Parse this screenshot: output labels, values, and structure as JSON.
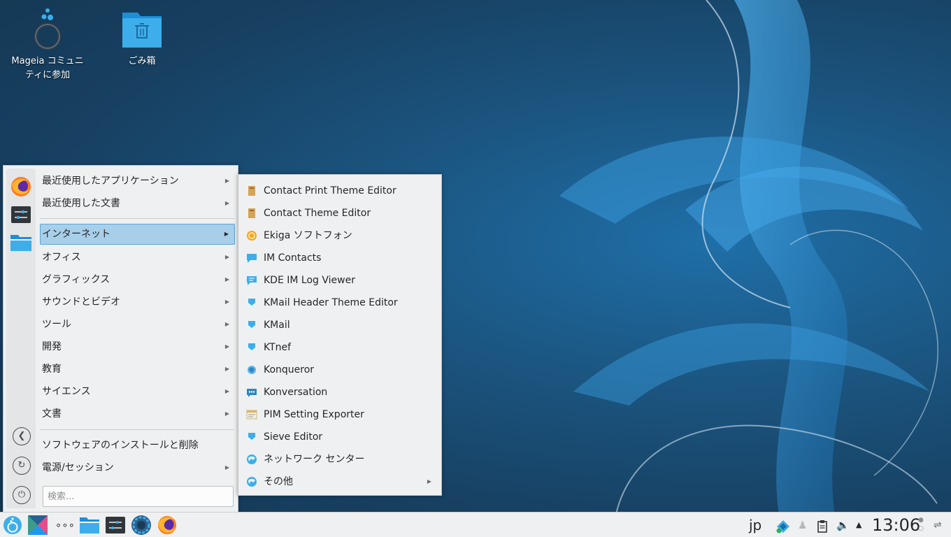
{
  "desktop": {
    "icons": [
      {
        "label": "Mageia コミュニ\nティに参加",
        "line1": "Mageia コミュニ",
        "line2": "ティに参加"
      },
      {
        "label": "ごみ箱"
      }
    ]
  },
  "start_menu": {
    "categories": [
      {
        "label": "最近使用したアプリケーション",
        "has_submenu": true
      },
      {
        "label": "最近使用した文書",
        "has_submenu": true
      },
      {
        "label": "インターネット",
        "has_submenu": true,
        "active": true
      },
      {
        "label": "オフィス",
        "has_submenu": true
      },
      {
        "label": "グラフィックス",
        "has_submenu": true
      },
      {
        "label": "サウンドとビデオ",
        "has_submenu": true
      },
      {
        "label": "ツール",
        "has_submenu": true
      },
      {
        "label": "開発",
        "has_submenu": true
      },
      {
        "label": "教育",
        "has_submenu": true
      },
      {
        "label": "サイエンス",
        "has_submenu": true
      },
      {
        "label": "文書",
        "has_submenu": true
      }
    ],
    "software_label": "ソフトウェアのインストールと削除",
    "power_label": "電源/セッション",
    "search_placeholder": "検索...",
    "favorites": [
      "firefox-icon",
      "system-settings-icon",
      "file-manager-icon"
    ],
    "system_buttons": [
      "back-icon",
      "switch-user-icon",
      "power-icon"
    ]
  },
  "submenu": {
    "items": [
      {
        "label": "Contact Print Theme Editor",
        "icon": "theme-editor-icon"
      },
      {
        "label": "Contact Theme Editor",
        "icon": "theme-editor-icon"
      },
      {
        "label": "Ekiga ソフトフォン",
        "icon": "ekiga-icon"
      },
      {
        "label": "IM Contacts",
        "icon": "chat-icon"
      },
      {
        "label": "KDE IM Log Viewer",
        "icon": "log-viewer-icon"
      },
      {
        "label": "KMail Header Theme Editor",
        "icon": "kmail-icon"
      },
      {
        "label": "KMail",
        "icon": "kmail-icon"
      },
      {
        "label": "KTnef",
        "icon": "kmail-icon"
      },
      {
        "label": "Konqueror",
        "icon": "konqueror-icon"
      },
      {
        "label": "Konversation",
        "icon": "konversation-icon"
      },
      {
        "label": "PIM Setting Exporter",
        "icon": "exporter-icon"
      },
      {
        "label": "Sieve Editor",
        "icon": "kmail-icon"
      },
      {
        "label": "ネットワーク センター",
        "icon": "network-center-icon"
      },
      {
        "label": "その他",
        "icon": "network-center-icon",
        "has_submenu": true
      }
    ]
  },
  "taskbar": {
    "launchers": [
      "mageia-menu-icon",
      "pager-icon",
      "more-icon",
      "file-manager-icon",
      "system-settings-icon",
      "mageia-control-center-icon",
      "firefox-icon"
    ],
    "more_label": "∘∘∘",
    "keyboard_layout": "jp",
    "clock": "13:06",
    "tray": [
      "network-icon",
      "user-icon",
      "clipboard-icon",
      "volume-icon",
      "expand-tray-icon",
      "lock-icon",
      "panel-settings-icon"
    ]
  },
  "colors": {
    "accent": "#3daee9",
    "highlight": "#a8cfe9",
    "panel": "#eff0f1"
  }
}
